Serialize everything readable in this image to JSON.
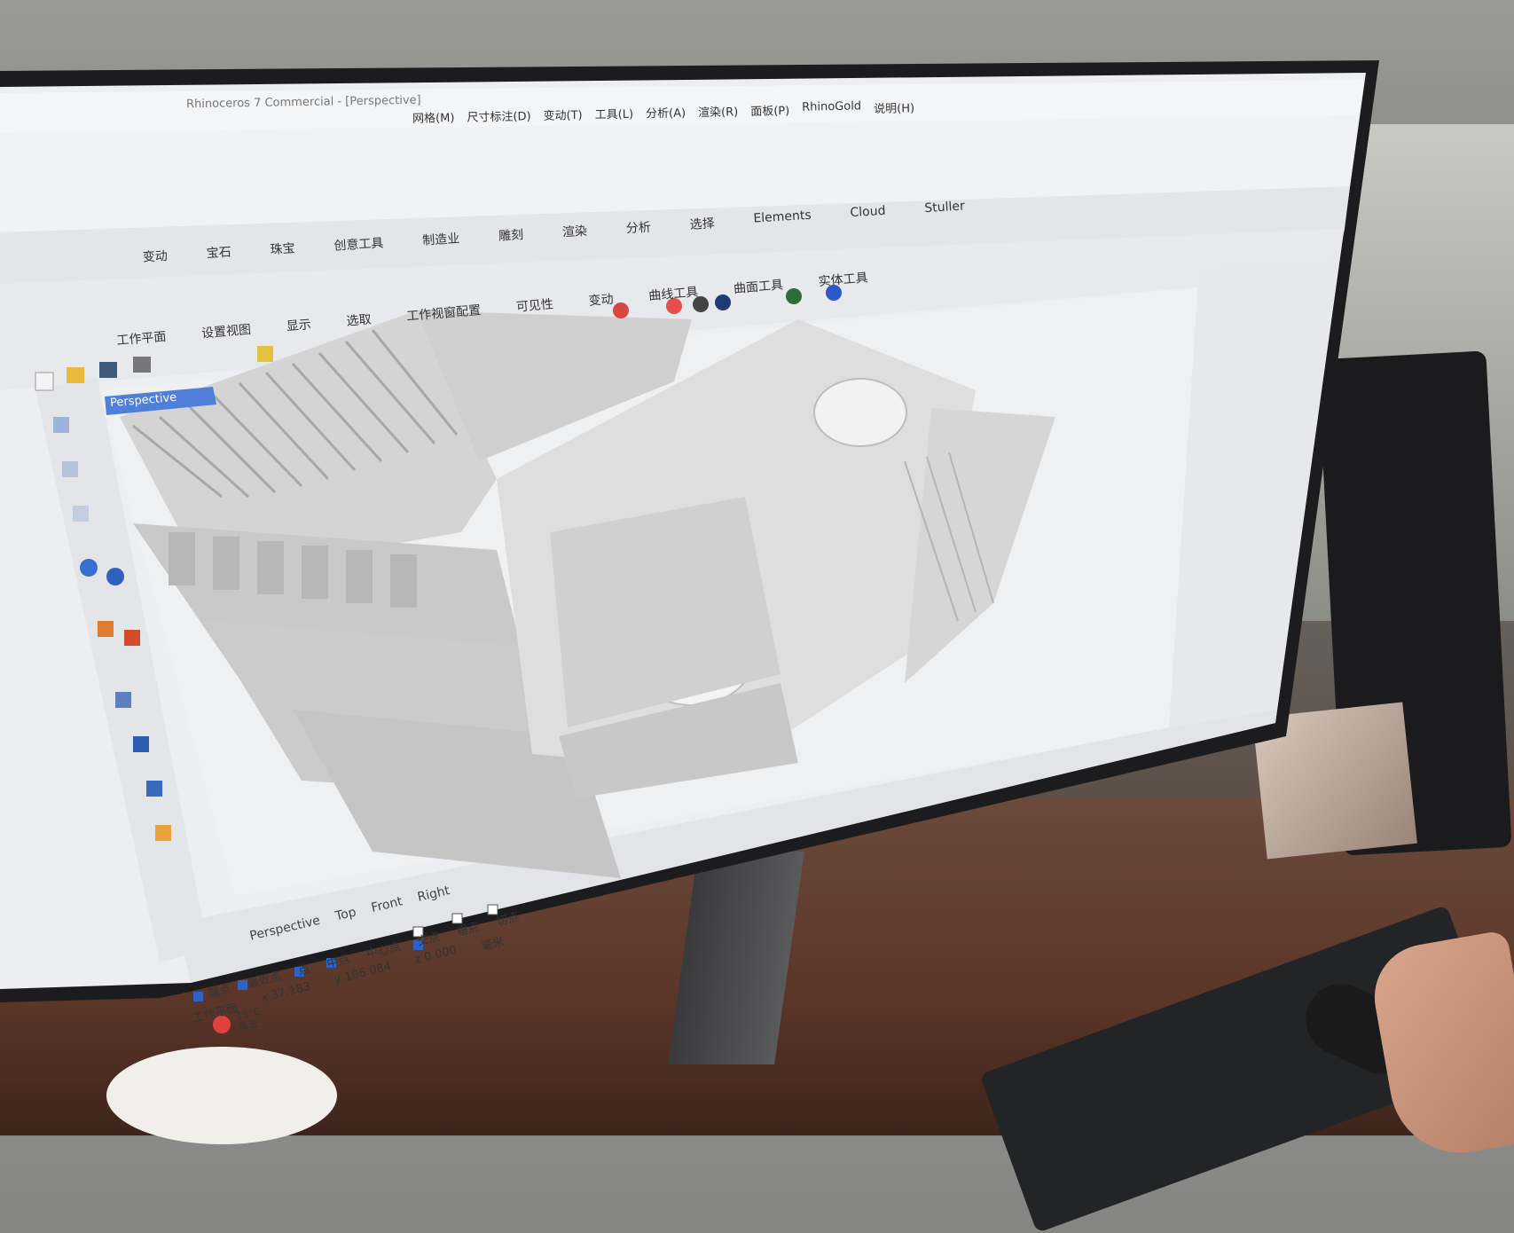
{
  "window_title": "Rhinoceros 7 Commercial - [Perspective]",
  "menu": {
    "items": [
      "网格(M)",
      "尺寸标注(D)",
      "变动(T)",
      "工具(L)",
      "分析(A)",
      "渲染(R)",
      "面板(P)",
      "RhinoGold",
      "说明(H)"
    ]
  },
  "ribbon_tabs": [
    "变动",
    "宝石",
    "珠宝",
    "创意工具",
    "制造业",
    "雕刻",
    "渲染",
    "分析",
    "选择",
    "Elements",
    "Cloud",
    "Stuller"
  ],
  "toolbar_groups": [
    "工作平面",
    "设置视图",
    "显示",
    "选取",
    "工作视窗配置",
    "可见性",
    "变动",
    "曲线工具",
    "曲面工具",
    "实体工具"
  ],
  "viewport_label": "Perspective",
  "viewport_tabs": [
    "Perspective",
    "Top",
    "Front",
    "Right"
  ],
  "osnap": {
    "items": [
      {
        "label": "端点",
        "checked": true
      },
      {
        "label": "最近点",
        "checked": true
      },
      {
        "label": "点",
        "checked": true
      },
      {
        "label": "中点",
        "checked": true
      },
      {
        "label": "中心点",
        "checked": false
      },
      {
        "label": "交点",
        "checked": true
      },
      {
        "label": "垂点",
        "checked": false
      },
      {
        "label": "切点",
        "checked": false
      }
    ]
  },
  "status": {
    "cplane": "工作平面",
    "x": "x 37.183",
    "y": "y 106.084",
    "z": "z 0.000",
    "unit": "毫米"
  },
  "weather": {
    "temp": "15°C",
    "condition": "多云"
  },
  "colors": {
    "ui_bg": "#e9eaee",
    "viewport_bg": "#ecedef",
    "model": "#d9d9d9",
    "viewport_label_bg": "#4f7fd9",
    "checkbox": "#2c63c7"
  }
}
